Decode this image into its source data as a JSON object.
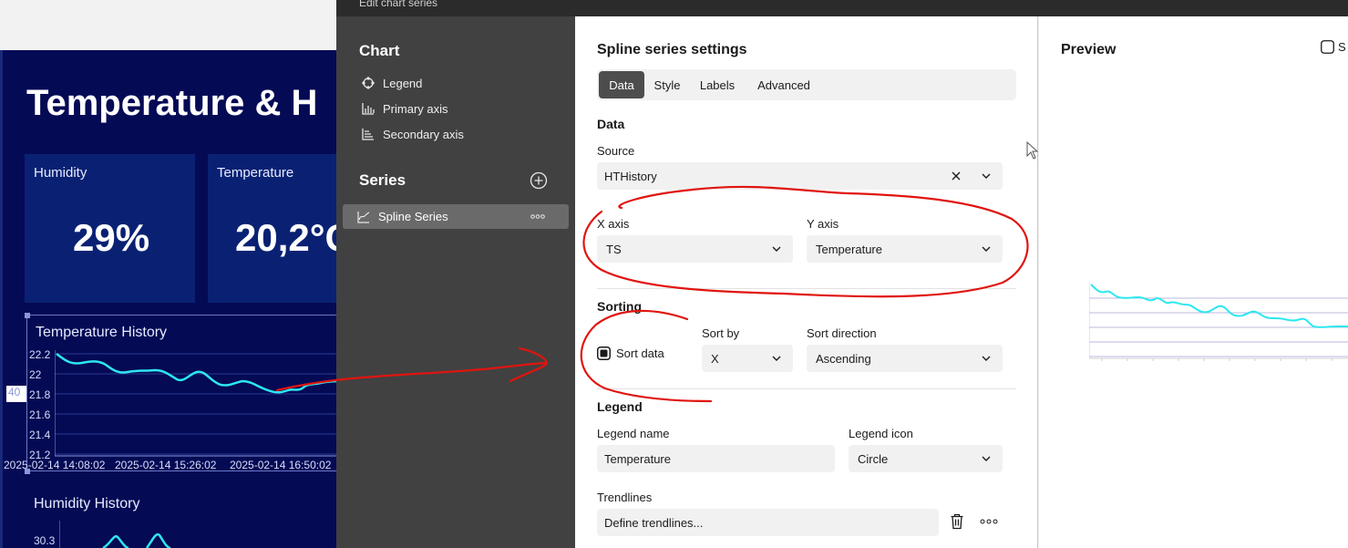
{
  "dashboard": {
    "title": "Temperature & H",
    "kpis": [
      {
        "label": "Humidity",
        "value": "29%"
      },
      {
        "label": "Temperature",
        "value": "20,2°C"
      }
    ],
    "temp_chart": {
      "title": "Temperature History",
      "y_ticks": [
        "22.2",
        "22",
        "21.8",
        "21.6",
        "21.4",
        "21.2"
      ],
      "x_ticks": [
        "2025-02-14 14:08:02",
        "2025-02-14 15:26:02",
        "2025-02-14 16:50:02"
      ],
      "side_tag": "40"
    },
    "humidity_chart": {
      "title": "Humidity History",
      "y_ticks": [
        "30.3"
      ]
    },
    "colors": {
      "background": "#040a54",
      "tile": "#0a2173",
      "line": "#2de7ef"
    }
  },
  "dialog": {
    "title": "Edit chart series",
    "sidebar": {
      "chart_heading": "Chart",
      "chart_items": [
        {
          "label": "Legend",
          "icon": "legend-icon"
        },
        {
          "label": "Primary axis",
          "icon": "primary-axis-icon"
        },
        {
          "label": "Secondary axis",
          "icon": "secondary-axis-icon"
        }
      ],
      "series_heading": "Series",
      "series_items": [
        {
          "label": "Spline Series",
          "icon": "spline-chart-icon"
        }
      ]
    },
    "settings": {
      "heading": "Spline series settings",
      "tabs": [
        "Data",
        "Style",
        "Labels",
        "Advanced"
      ],
      "active_tab": "Data",
      "data_section": "Data",
      "source_label": "Source",
      "source_value": "HTHistory",
      "x_axis_label": "X axis",
      "x_axis_value": "TS",
      "y_axis_label": "Y axis",
      "y_axis_value": "Temperature",
      "sorting_section": "Sorting",
      "sort_data_label": "Sort data",
      "sort_data_checked": true,
      "sort_by_label": "Sort by",
      "sort_by_value": "X",
      "sort_direction_label": "Sort direction",
      "sort_direction_value": "Ascending",
      "legend_section": "Legend",
      "legend_name_label": "Legend name",
      "legend_name_value": "Temperature",
      "legend_icon_label": "Legend icon",
      "legend_icon_value": "Circle",
      "trendlines_label": "Trendlines",
      "trendlines_value": "Define trendlines..."
    },
    "preview": {
      "heading": "Preview",
      "checkbox_label": "S"
    }
  }
}
